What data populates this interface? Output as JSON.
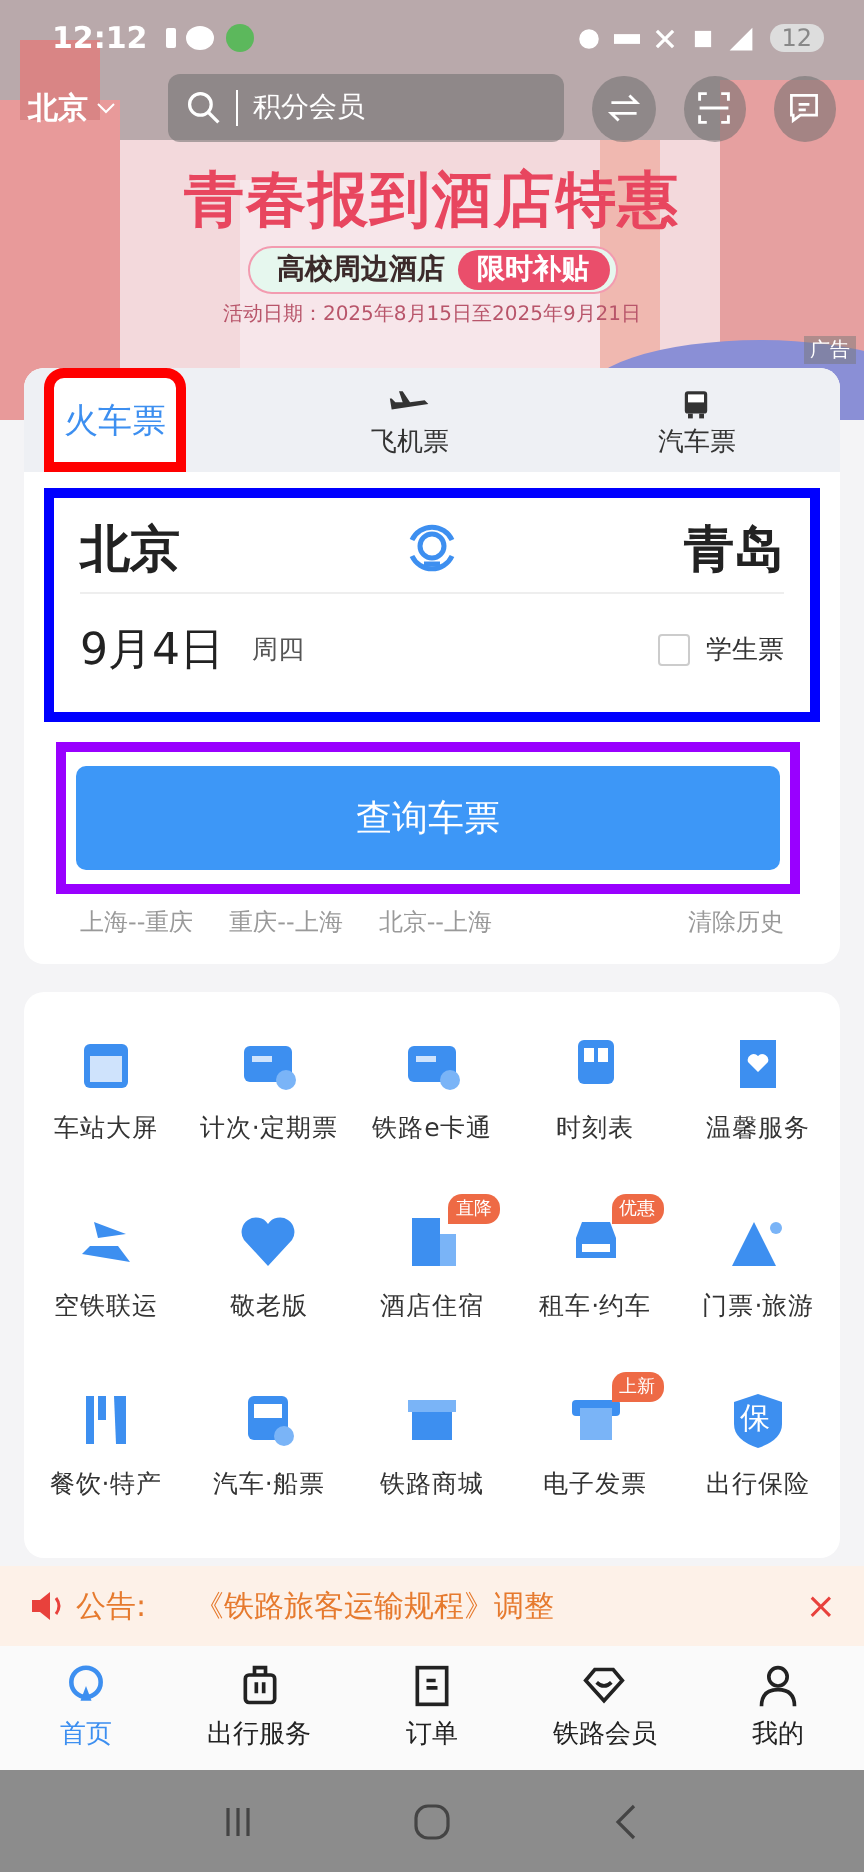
{
  "status_bar": {
    "time": "12:12",
    "battery": "12"
  },
  "header": {
    "city": "北京",
    "search": {
      "placeholder": "积分会员"
    }
  },
  "banner": {
    "title": "青春报到酒店特惠",
    "pill_text": "高校周边酒店",
    "pill_badge": "限时补贴",
    "dates": "活动日期：2025年8月15日至2025年9月21日",
    "ad_label": "广告"
  },
  "tabs": [
    {
      "label": "火车票",
      "selected": true,
      "highlighted": true
    },
    {
      "label": "飞机票",
      "selected": false,
      "highlighted": false
    },
    {
      "label": "汽车票",
      "selected": false,
      "highlighted": false
    }
  ],
  "route": {
    "from": "北京",
    "to": "青岛",
    "date": "9月4日",
    "weekday": "周四",
    "student": {
      "label": "学生票",
      "checked": false
    },
    "highlighted": true
  },
  "search_button": {
    "label": "查询车票",
    "highlighted": true
  },
  "history": [
    "上海--重庆",
    "重庆--上海",
    "北京--上海"
  ],
  "clear_history": "清除历史",
  "services": [
    {
      "label": "车站大屏"
    },
    {
      "label": "计次·定期票"
    },
    {
      "label": "铁路e卡通"
    },
    {
      "label": "时刻表"
    },
    {
      "label": "温馨服务"
    },
    {
      "label": "空铁联运"
    },
    {
      "label": "敬老版"
    },
    {
      "label": "酒店住宿",
      "badge": "直降"
    },
    {
      "label": "租车·约车",
      "badge": "优惠"
    },
    {
      "label": "门票·旅游"
    },
    {
      "label": "餐饮·特产"
    },
    {
      "label": "汽车·船票"
    },
    {
      "label": "铁路商城"
    },
    {
      "label": "电子发票",
      "badge": "上新"
    },
    {
      "label": "出行保险",
      "icon_text": "保"
    }
  ],
  "notice": {
    "label": "公告:",
    "text": "《铁路旅客运输规程》调整",
    "close": "×"
  },
  "bottom_nav": [
    {
      "label": "首页",
      "selected": true
    },
    {
      "label": "出行服务",
      "selected": false
    },
    {
      "label": "订单",
      "selected": false
    },
    {
      "label": "铁路会员",
      "selected": false
    },
    {
      "label": "我的",
      "selected": false
    }
  ]
}
